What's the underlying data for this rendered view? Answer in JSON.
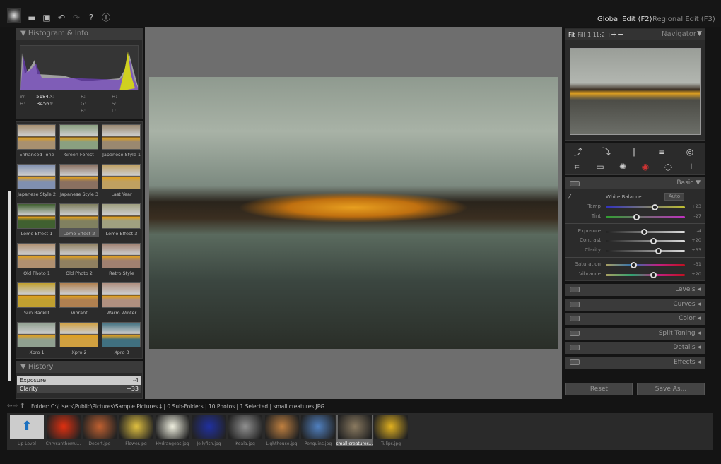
{
  "toolbar": {
    "icons": [
      "app-logo",
      "open-folder-icon",
      "save-icon",
      "undo-icon",
      "redo-icon",
      "help-icon",
      "info-icon"
    ],
    "help": "?",
    "info": "ⓘ"
  },
  "modes": {
    "global": "Global Edit (F2)",
    "regional": "Regional Edit (F3)"
  },
  "histogram": {
    "title": "Histogram & Info",
    "W": "5184",
    "H": "3456",
    "labels": {
      "w": "W:",
      "h": "H:",
      "x": "X:",
      "y": "Y:",
      "r": "R:",
      "g": "G:",
      "b": "B:",
      "hh": "H:",
      "s": "S:",
      "l": "L:"
    },
    "dash": "-"
  },
  "presets": [
    "Enhanced Tone",
    "Green Forest",
    "Japanese Style 1",
    "Japanese Style 2",
    "Japanese Style 3",
    "Last Year",
    "Lomo Effect 1",
    "Lomo Effect 2",
    "Lomo Effect 3",
    "Old Photo 1",
    "Old Photo 2",
    "Retro Style",
    "Sun Backlit",
    "Vibrant",
    "Warm Winter",
    "Xpro 1",
    "Xpro 2",
    "Xpro 3"
  ],
  "history": {
    "title": "History",
    "items": [
      {
        "label": "Exposure",
        "value": "-4"
      },
      {
        "label": "Clarity",
        "value": "+33"
      }
    ]
  },
  "navigator": {
    "fit": "Fit",
    "fill": "Fill",
    "one": "1:1",
    "half": "1:2 ÷",
    "plus": "+",
    "minus": "−",
    "title": "Navigator"
  },
  "basic": {
    "title": "Basic",
    "white_balance": "White Balance",
    "auto": "Auto",
    "sliders": [
      {
        "label": "Temp",
        "value": "+23",
        "pos": 0.62
      },
      {
        "label": "Tint",
        "value": "-27",
        "pos": 0.38
      },
      {
        "label": "Exposure",
        "value": "-4",
        "pos": 0.48
      },
      {
        "label": "Contrast",
        "value": "+20",
        "pos": 0.6
      },
      {
        "label": "Clarity",
        "value": "+33",
        "pos": 0.66
      },
      {
        "label": "Saturation",
        "value": "-31",
        "pos": 0.35
      },
      {
        "label": "Vibrance",
        "value": "+20",
        "pos": 0.6
      }
    ]
  },
  "sections": [
    "Levels",
    "Curves",
    "Color",
    "Split Toning",
    "Details",
    "Effects"
  ],
  "buttons": {
    "reset": "Reset",
    "save_as": "Save As..."
  },
  "folder": {
    "label": "Folder:",
    "path": "C:\\Users\\Public\\Pictures\\Sample Pictures ‡ | 0 Sub-Folders | 10 Photos | 1 Selected | small creatures.JPG"
  },
  "filmstrip": [
    "Up Level",
    "Chrysanthemu...",
    "Desert.jpg",
    "Flower.jpg",
    "Hydrangeas.jpg",
    "Jellyfish.jpg",
    "Koala.jpg",
    "Lighthouse.jpg",
    "Penguins.jpg",
    "small creatures...",
    "Tulips.jpg"
  ],
  "selected_film": "small creatures..."
}
